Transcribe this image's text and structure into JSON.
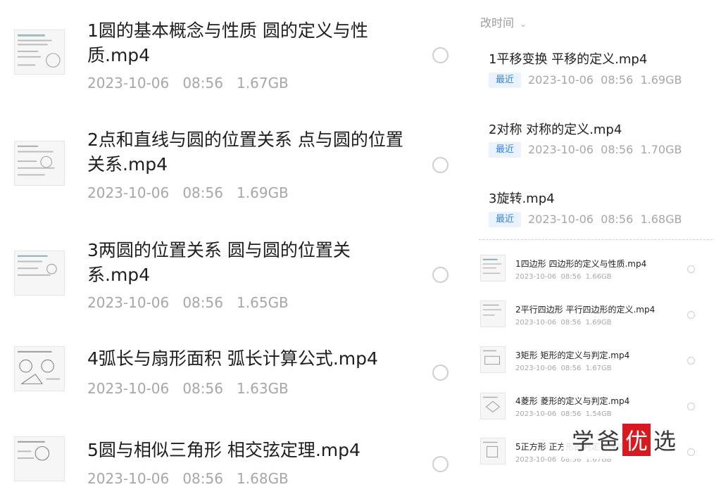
{
  "left_list": [
    {
      "title": "1圆的基本概念与性质 圆的定义与性质.mp4",
      "date": "2023-10-06",
      "time": "08:56",
      "size": "1.67GB"
    },
    {
      "title": "2点和直线与圆的位置关系 点与圆的位置关系.mp4",
      "date": "2023-10-06",
      "time": "08:56",
      "size": "1.69GB"
    },
    {
      "title": "3两圆的位置关系 圆与圆的位置关系.mp4",
      "date": "2023-10-06",
      "time": "08:56",
      "size": "1.65GB"
    },
    {
      "title": "4弧长与扇形面积 弧长计算公式.mp4",
      "date": "2023-10-06",
      "time": "08:56",
      "size": "1.63GB"
    },
    {
      "title": "5圆与相似三角形 相交弦定理.mp4",
      "date": "2023-10-06",
      "time": "08:56",
      "size": "1.68GB"
    }
  ],
  "right_sort_label": "改时间",
  "right_recent": [
    {
      "title": "1平移变换 平移的定义.mp4",
      "badge": "最近",
      "date": "2023-10-06",
      "time": "08:56",
      "size": "1.69GB"
    },
    {
      "title": "2对称 对称的定义.mp4",
      "badge": "最近",
      "date": "2023-10-06",
      "time": "08:56",
      "size": "1.70GB"
    },
    {
      "title": "3旋转.mp4",
      "badge": "最近",
      "date": "2023-10-06",
      "time": "08:56",
      "size": "1.68GB"
    }
  ],
  "right_small": [
    {
      "title": "1四边形 四边形的定义与性质.mp4",
      "date": "2023-10-06",
      "time": "08:56",
      "size": "1.66GB"
    },
    {
      "title": "2平行四边形 平行四边形的定义.mp4",
      "date": "2023-10-06",
      "time": "08:56",
      "size": "1.69GB"
    },
    {
      "title": "3矩形 矩形的定义与判定.mp4",
      "date": "2023-10-06",
      "time": "08:56",
      "size": "1.67GB"
    },
    {
      "title": "4菱形 菱形的定义与判定.mp4",
      "date": "2023-10-06",
      "time": "08:56",
      "size": "1.54GB"
    },
    {
      "title": "5正方形 正方形的判定与性质.mp4",
      "date": "2023-10-06",
      "time": "08:56",
      "size": "1.67GB"
    }
  ],
  "watermark": {
    "chars": [
      "学",
      "爸",
      "优",
      "选"
    ]
  },
  "colors": {
    "badge_text": "#3b82d6",
    "badge_bg": "#eaf3fb",
    "meta_text": "#a7a7a7",
    "watermark_red": "#d71920"
  }
}
